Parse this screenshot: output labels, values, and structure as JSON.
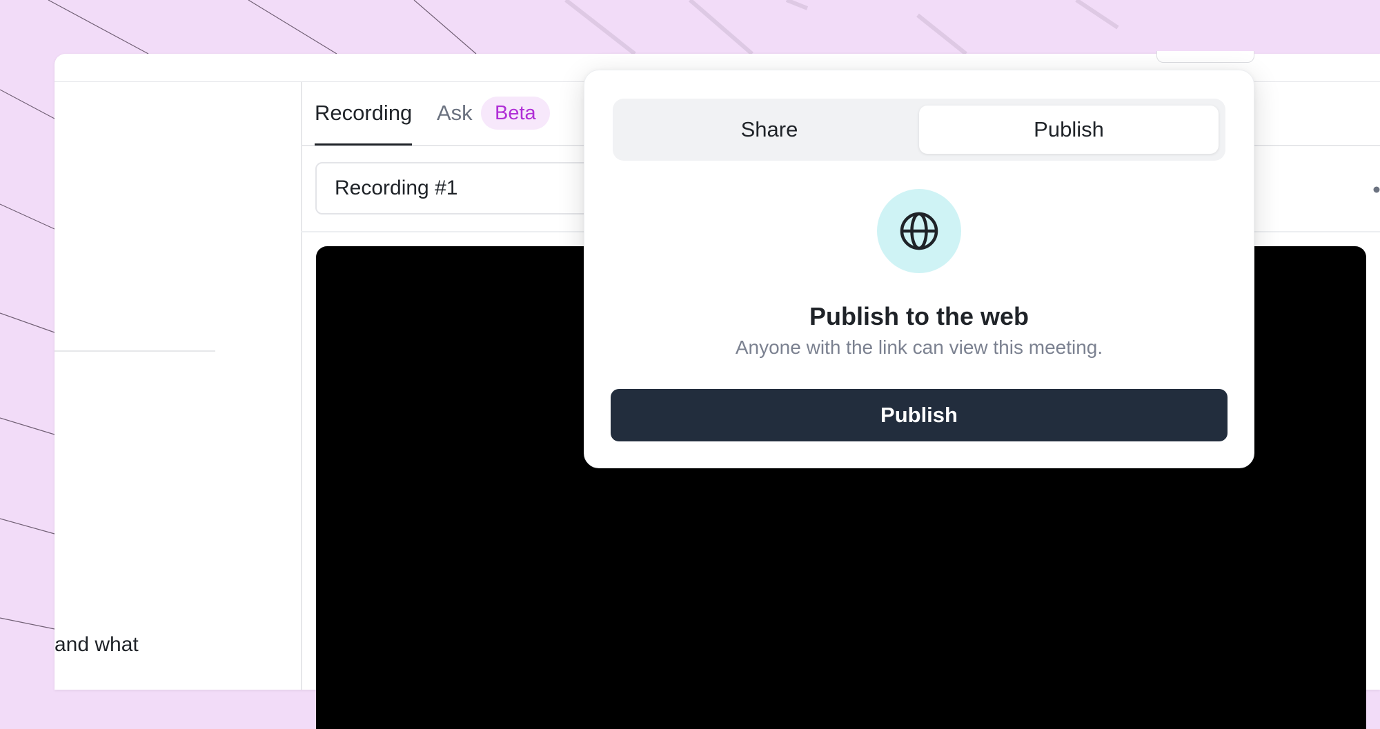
{
  "left_panel": {
    "snippet": "and what"
  },
  "tabs": [
    {
      "label": "Recording",
      "active": true
    },
    {
      "label": "Ask",
      "badge": "Beta"
    }
  ],
  "recording": {
    "title_value": "Recording #1"
  },
  "popover": {
    "segments": [
      "Share",
      "Publish"
    ],
    "active_segment": "Publish",
    "icon": "globe-icon",
    "title": "Publish to the web",
    "subtitle": "Anyone with the link can view this meeting.",
    "button_label": "Publish"
  },
  "colors": {
    "background": "#f2dcf8",
    "primary_button": "#222d3d",
    "icon_bg": "#cff3f5",
    "beta_text": "#b02fd6",
    "beta_bg": "#f7e8fb"
  }
}
